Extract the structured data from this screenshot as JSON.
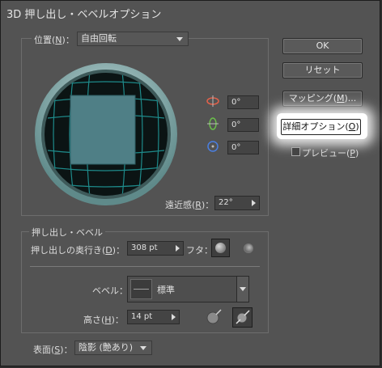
{
  "window": {
    "title": "3D 押し出し・ベベルオプション"
  },
  "position": {
    "label_prefix": "位置(",
    "label_key": "N",
    "label_suffix": ")：",
    "value": "自由回転",
    "rot_x": "0°",
    "rot_y": "0°",
    "rot_z": "0°",
    "perspective_prefix": "遠近感(",
    "perspective_key": "R",
    "perspective_suffix": ")：",
    "perspective_value": "22°"
  },
  "buttons": {
    "ok": "OK",
    "reset": "リセット",
    "mapping_prefix": "マッピング(",
    "mapping_key": "M",
    "mapping_suffix": ")...",
    "advanced_prefix": "詳細オプション(",
    "advanced_key": "O",
    "advanced_suffix": ")",
    "preview_prefix": "プレビュー(",
    "preview_key": "P",
    "preview_suffix": ")"
  },
  "extrude": {
    "section_title": "押し出し・ベベル",
    "depth_prefix": "押し出しの奥行き(",
    "depth_key": "D",
    "depth_suffix": ")：",
    "depth_value": "308 pt",
    "cap_label": "フタ：",
    "bevel_label": "ベベル：",
    "bevel_value": "標準",
    "height_prefix": "高さ(",
    "height_key": "H",
    "height_suffix": ")：",
    "height_value": "14 pt"
  },
  "surface": {
    "label_prefix": "表面(",
    "label_key": "S",
    "label_suffix": ")：",
    "value": "陰影 (艶あり)"
  },
  "colors": {
    "track_ring": "#8fb4b4",
    "grid_line": "#1e8a8a",
    "cube_face": "#4f7f86",
    "sphere_bg": "#0b1414",
    "rot_x_icon": "#e2614a",
    "rot_y_icon": "#6bbf4a",
    "rot_z_icon": "#4a7fe2"
  }
}
